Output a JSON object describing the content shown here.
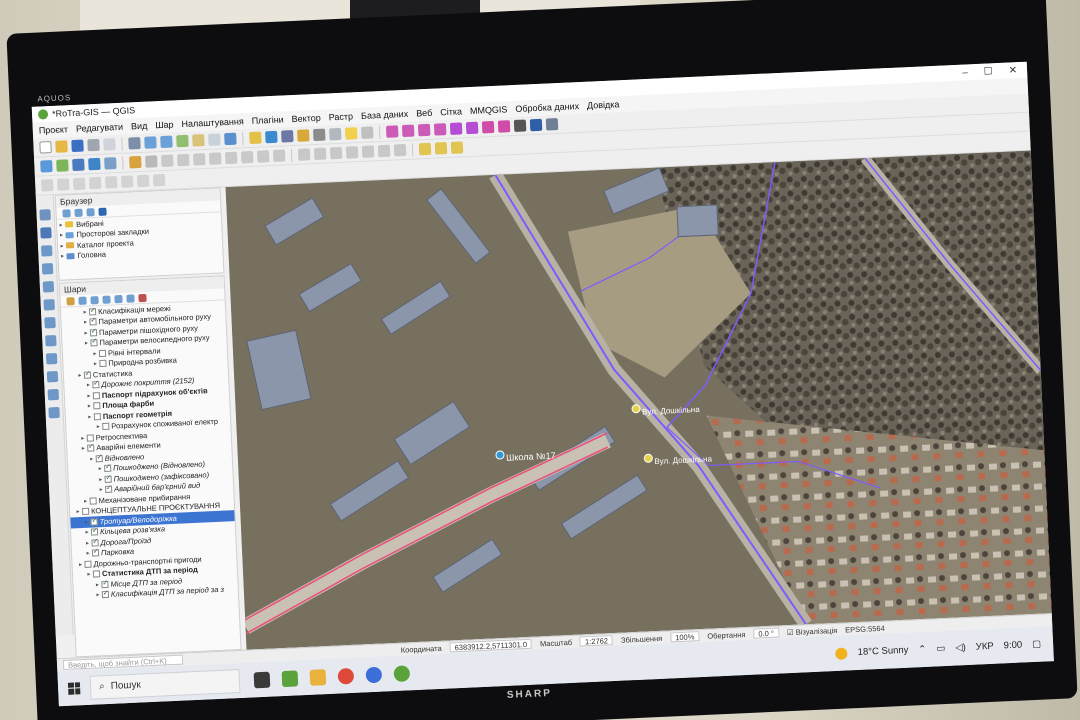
{
  "monitor": {
    "brand_top": "AQUOS",
    "brand_bottom": "SHARP"
  },
  "window": {
    "title": "*RoTra-GIS — QGIS",
    "controls": [
      "–",
      "☐",
      "✕"
    ]
  },
  "menu": [
    "Проєкт",
    "Редагувати",
    "Вид",
    "Шар",
    "Налаштування",
    "Плагіни",
    "Вектор",
    "Растр",
    "База даних",
    "Веб",
    "Сітка",
    "MMQGIS",
    "Обробка даних",
    "Довідка"
  ],
  "browser_panel": {
    "title": "Браузер",
    "items": [
      {
        "label": "Вибрані",
        "icon": "star-icon"
      },
      {
        "label": "Просторові закладки",
        "icon": "bookmark-icon"
      },
      {
        "label": "Каталог проекта",
        "icon": "folder-icon"
      },
      {
        "label": "Головна",
        "icon": "home-icon"
      }
    ]
  },
  "layers_panel": {
    "title": "Шари",
    "items": [
      {
        "label": "Класифікація мережі",
        "indent": 2,
        "style": "normal",
        "checked": true
      },
      {
        "label": "Параметри автомобільного руху",
        "indent": 2,
        "style": "normal",
        "checked": true
      },
      {
        "label": "Параметри пішохідного руху",
        "indent": 2,
        "style": "normal",
        "checked": true
      },
      {
        "label": "Параметри велосипедного руху",
        "indent": 2,
        "style": "normal",
        "checked": true
      },
      {
        "label": "Рівні інтервали",
        "indent": 3,
        "style": "normal",
        "checked": false
      },
      {
        "label": "Природна розбивка",
        "indent": 3,
        "style": "normal",
        "checked": false
      },
      {
        "label": "Статистика",
        "indent": 1,
        "style": "normal",
        "checked": true
      },
      {
        "label": "Дорожнє покриття (2152)",
        "indent": 2,
        "style": "ital",
        "checked": true
      },
      {
        "label": "Паспорт підрахунок об'єктів",
        "indent": 2,
        "style": "bold",
        "checked": false
      },
      {
        "label": "Площа фарби",
        "indent": 2,
        "style": "bold",
        "checked": false
      },
      {
        "label": "Паспорт геометрія",
        "indent": 2,
        "style": "bold",
        "checked": false
      },
      {
        "label": "Розрахунок споживаної електр",
        "indent": 3,
        "style": "normal",
        "checked": false
      },
      {
        "label": "Ретроспектива",
        "indent": 1,
        "style": "normal",
        "checked": false
      },
      {
        "label": "Аварійні елементи",
        "indent": 1,
        "style": "normal",
        "checked": true
      },
      {
        "label": "Відновлено",
        "indent": 2,
        "style": "ital",
        "checked": true
      },
      {
        "label": "Пошкоджено (Відновлено)",
        "indent": 3,
        "style": "ital",
        "checked": true
      },
      {
        "label": "Пошкоджено (зафіксовано)",
        "indent": 3,
        "style": "ital",
        "checked": true
      },
      {
        "label": "Аварійний бар'єрний вид",
        "indent": 3,
        "style": "ital",
        "checked": true
      },
      {
        "label": "Механізоване прибирання",
        "indent": 1,
        "style": "normal",
        "checked": false
      },
      {
        "label": "КОНЦЕПТУАЛЬНЕ ПРОЄКТУВАННЯ",
        "indent": 0,
        "style": "normal",
        "checked": false
      },
      {
        "label": "Тротуар/Велодоріжка",
        "indent": 1,
        "style": "sel",
        "checked": true
      },
      {
        "label": "Кільцева розв'язка",
        "indent": 1,
        "style": "ital",
        "checked": true
      },
      {
        "label": "Дорога/Проїзд",
        "indent": 1,
        "style": "ital",
        "checked": true
      },
      {
        "label": "Парковка",
        "indent": 1,
        "style": "ital",
        "checked": true
      },
      {
        "label": "Дорожньо-транспортні пригоди",
        "indent": 0,
        "style": "normal",
        "checked": false
      },
      {
        "label": "Статистика ДТП за період",
        "indent": 1,
        "style": "bold",
        "checked": false
      },
      {
        "label": "Місце ДТП за період",
        "indent": 2,
        "style": "ital",
        "checked": true
      },
      {
        "label": "Класифікація ДТП за період за з",
        "indent": 2,
        "style": "ital",
        "checked": true
      }
    ]
  },
  "map": {
    "labels": [
      "Школа №17",
      "Вул. Дошкільна",
      "Вул. Дошкільна"
    ]
  },
  "statusbar": {
    "search_placeholder": "Введіть, щоб знайти (Ctrl+K)",
    "coord_label": "Координата",
    "coord_value": "6383912.2,5711301.0",
    "scale_label": "Масштаб",
    "scale_value": "1:2762",
    "magnifier_label": "Збільшення",
    "magnifier_value": "100%",
    "rotation_label": "Обертання",
    "rotation_value": "0.0 °",
    "render_label": "Візуалізація",
    "crs": "EPSG:5564"
  },
  "taskbar": {
    "search_label": "Пошук",
    "weather": "18°C  Sunny",
    "lang": "УКР",
    "time": "9:00"
  },
  "colors": {
    "selection": "#3c74d2",
    "road_overlay": "#7b5cff",
    "road_red": "#e8527c",
    "qgis_green": "#5aa33a"
  }
}
